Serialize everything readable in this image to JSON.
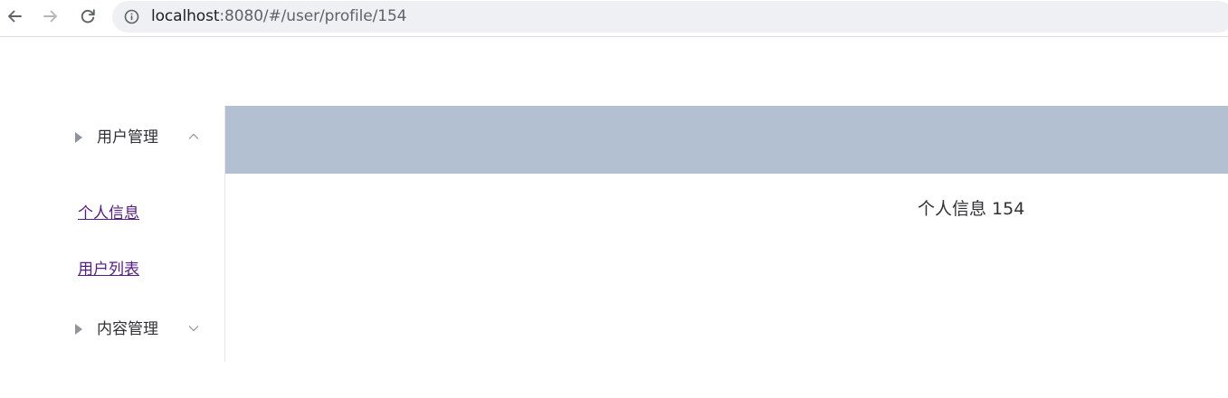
{
  "browser": {
    "url_host": "localhost",
    "url_rest": ":8080/#/user/profile/154"
  },
  "sidebar": {
    "menus": [
      {
        "label": "用户管理",
        "expanded": true,
        "items": [
          {
            "label": "个人信息"
          },
          {
            "label": "用户列表"
          }
        ]
      },
      {
        "label": "内容管理",
        "expanded": false,
        "items": []
      }
    ]
  },
  "main": {
    "content_text": "个人信息 154"
  },
  "colors": {
    "header_bar": "#b3c0d1",
    "visited_link": "#551a8b"
  }
}
